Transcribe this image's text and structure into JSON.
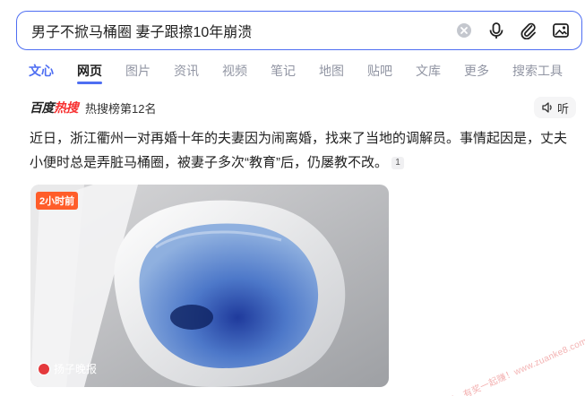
{
  "search": {
    "query": "男子不掀马桶圈 妻子跟擦10年崩溃",
    "icons": [
      "clear-icon",
      "microphone-icon",
      "attachment-icon",
      "image-search-icon"
    ]
  },
  "tabs": [
    {
      "label": "文心",
      "state": "ai"
    },
    {
      "label": "网页",
      "state": "active"
    },
    {
      "label": "图片",
      "state": ""
    },
    {
      "label": "资讯",
      "state": ""
    },
    {
      "label": "视频",
      "state": ""
    },
    {
      "label": "笔记",
      "state": ""
    },
    {
      "label": "地图",
      "state": ""
    },
    {
      "label": "贴吧",
      "state": ""
    },
    {
      "label": "文库",
      "state": ""
    },
    {
      "label": "更多",
      "state": ""
    },
    {
      "label": "搜索工具",
      "state": ""
    }
  ],
  "hot": {
    "logo_black": "百度",
    "logo_red": "热搜",
    "rank": "热搜榜第12名",
    "listen": "听"
  },
  "summary": {
    "text": "近日，浙江衢州一对再婚十年的夫妻因为闹离婚，找来了当地的调解员。事情起因是，丈夫小便时总是弄脏马桶圈，被妻子多次“教育”后，仍屡教不改。",
    "cite": "1"
  },
  "news": {
    "time": "2小时前",
    "source": "扬子晚报"
  },
  "watermark": "赚客吧，有奖一起赚！www.zuanke8.com",
  "colors": {
    "accent": "#4e6ef2",
    "hot_red": "#f73131",
    "badge": "#ff5d2a"
  }
}
